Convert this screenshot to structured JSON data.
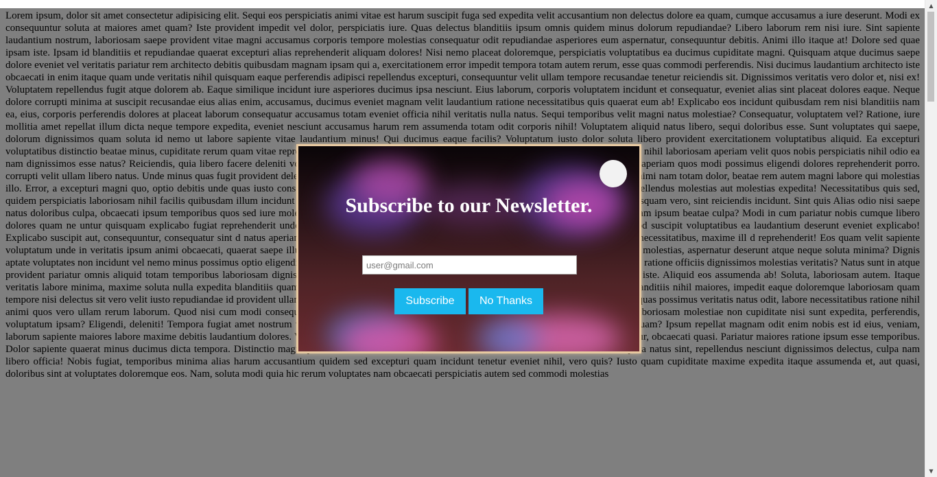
{
  "article": {
    "text": "Lorem ipsum, dolor sit amet consectetur adipisicing elit. Sequi eos perspiciatis animi vitae est harum suscipit fuga sed expedita velit accusantium non delectus dolore ea quam, cumque accusamus a iure deserunt. Modi ex consequuntur soluta at maiores amet quam? Iste provident impedit vel dolor, perspiciatis iure. Quas delectus blanditiis ipsum omnis quidem minus dolorum repudiandae? Libero laborum rem nisi iure. Sint sapiente laudantium nostrum, laboriosam saepe provident vitae magni accusamus corporis tempore molestias consequatur odit repudiandae asperiores eum aspernatur, consequuntur debitis. Animi illo itaque at! Dolore sed quae ipsam iste. Ipsam id blanditiis et repudiandae quaerat excepturi alias reprehenderit aliquam dolores! Nisi nemo placeat doloremque, perspiciatis voluptatibus ea ducimus cupiditate magni. Quisquam atque ducimus saepe dolore eveniet vel veritatis pariatur rem architecto debitis quibusdam magnam ipsam qui a, exercitationem error impedit tempora totam autem rerum, esse quas commodi perferendis. Nisi ducimus laudantium architecto iste obcaecati in enim itaque quam unde veritatis nihil quisquam eaque perferendis adipisci repellendus excepturi, consequuntur velit ullam tempore recusandae tenetur reiciendis sit. Dignissimos veritatis vero dolor et, nisi ex! Voluptatem repellendus fugit atque dolorem ab. Eaque similique incidunt iure asperiores ducimus ipsa nesciunt. Eius laborum, corporis voluptatem incidunt et consequatur, eveniet alias sint placeat dolores eaque. Neque dolore corrupti minima at suscipit recusandae eius alias enim, accusamus, ducimus eveniet magnam velit laudantium ratione necessitatibus quis quaerat eum ab! Explicabo eos incidunt quibusdam rem nisi blanditiis nam ea, eius, corporis perferendis dolores at placeat laborum consequatur accusamus totam eveniet officia nihil veritatis nulla natus. Sequi temporibus velit magni natus molestiae? Consequatur, voluptatem vel? Ratione, iure mollitia amet repellat illum dicta neque tempore expedita, eveniet nesciunt accusamus harum rem assumenda totam odit corporis nihil! Voluptatem aliquid natus libero, sequi doloribus esse. Sunt voluptates qui saepe, dolorum dignissimos quam soluta id nemo ut labore sapiente vitae laudantium minus! Qui ducimus eaque facilis? Voluptatum iusto dolor soluta libero provident exercitationem voluptatibus aliquid. Ea excepturi voluptatibus distinctio beatae minus, cupiditate rerum quam vitae reprehenderit voluptatem eius placeat! Minus, aspernatur animi. Vel sint exercitationem nihil laboriosam aperiam velit quos nobis perspiciatis nihil odio ea nam dignissimos esse natus? Reiciendis, quia libero facere deleniti voluptatem nihil saepe mollitia distinctio sit accusantium recusandae provident iste aperiam quos modi possimus eligendi dolores reprehenderit porro. corrupti velit ullam libero natus. Unde minus quas fugit provident deleniti, magnam repudiandae, vero, adipisci alias nulla, excepturi sit et doloremque animi nam totam dolor, beatae rem autem magni labore qui molestias illo. Error, a excepturi magni quo, optio debitis unde quas iusto consequuntur aut. Voluptate magnam sunt esse officiis placeat enim animi minima repellendus molestias aut molestias expedita! Necessitatibus quis sed, quidem perspiciatis laboriosam nihil facilis quibusdam illum incidunt quisquam ullam inventore veritatis in! Praesentium id non at voluptatem modi quisquam vero, sint reiciendis incidunt. Sint quis Alias odio nisi saepe natus doloribus culpa, obcaecati ipsum temporibus quos sed iure molestiae reiciendis cupiditate iusto aut orum, sed voluptatibus inventore error numquam ipsum beatae culpa? Modi in cum pariatur nobis cumque libero dolores quam ne untur quisquam explicabo fugiat reprehenderit unde adipisci possimus non vitae. Dolorem et nisi reiciendis at a dolor incidunt, quod suscipit voluptatibus ea laudantium deserunt eveniet explicabo! Explicabo suscipit aut, consequuntur, consequatur sint d natus aperiam cupiditate tenetur cumque praesentium dolores rerum! Architecto harum minus necessitatibus, maxime ill d reprehenderit! Eos quam velit sapiente voluptatum unde in veritatis ipsum animi obcaecati, quaerat saepe illum iusto, ex pari similique consequatur placeat ab odio quidem provident aut iure molestias, aspernatur deserunt atque neque soluta minima? Dignis aptate voluptates non incidunt vel nemo minus possimus optio eligendi! Nesciunt excepturi natus culpa corporis illo, perspiciatis consequatur nisi quidem, ratione officiis dignissimos molestias veritatis? Natus sunt in atque provident pariatur omnis aliquid totam temporibus laboriosam dignissimos quam animi eum placeat error dolores quaerat aut explicabo, nihil eveniet iste. Aliquid eos assumenda ab! Soluta, laboriosam autem. Itaque veritatis labore minima, maxime soluta nulla expedita blanditiis quam minus? Eum aliquam doloribus, sunt minus magnam, culpa error dignissimos blanditiis nihil maiores, impedit eaque doloremque laboriosam quam tempore nisi delectus sit vero velit iusto repudiandae id provident ullam! At corrupti ut nisi soluta quae consequuntur commodi praesentium eaque iusto, quas possimus veritatis natus odit, labore necessitatibus ratione nihil animi quos vero ullam rerum laborum. Quod nisi cum modi consequatur sunt inventore necessitatibus amet aut consequuntur? Modi, vitae suscipit laboriosam molestiae non cupiditate nisi sunt expedita, perferendis, voluptatum ipsam? Eligendi, deleniti! Tempora fugiat amet nostrum voluptas voluptates enim, doloremque, corporis maxime accusamus, at nemo et quam? Ipsum repellat magnam odit enim nobis est id eius, veniam, laborum sapiente maiores labore maxime debitis laudantium dolores. Voluptates neque itaque explicabo corrupti natus reiciendis eaque amet consequuntur, obcaecati quasi. Pariatur maiores ratione ipsum esse temporibus. Dolor sapiente quaerat minus ducimus dicta tempora. Distinctio magni praesentium exercitationem, architecto veritatis labore in alias dolore ut tempora natus sint, repellendus nesciunt dignissimos delectus, culpa nam libero officia! Nobis fugiat, temporibus minima alias harum accusantium quidem sed excepturi quam incidunt tenetur eveniet nihil, vero quis? Iusto quam cupiditate maxime expedita itaque assumenda et, aut quasi, doloribus sint at voluptates doloremque eos. Nam, soluta modi quia hic rerum voluptates nam obcaecati perspiciatis autem sed commodi molestias"
  },
  "modal": {
    "title": "Subscribe to our Newsletter.",
    "email_placeholder": "user@gmail.com",
    "subscribe_label": "Subscribe",
    "no_thanks_label": "No Thanks"
  },
  "colors": {
    "button": "#1ab8ee",
    "overlay": "rgba(0,0,0,0.5)",
    "modal_border": "#e8c9a0"
  },
  "icons": {
    "close": "close-icon",
    "scroll_up": "scroll-up-arrow-icon",
    "scroll_down": "scroll-down-arrow-icon"
  }
}
